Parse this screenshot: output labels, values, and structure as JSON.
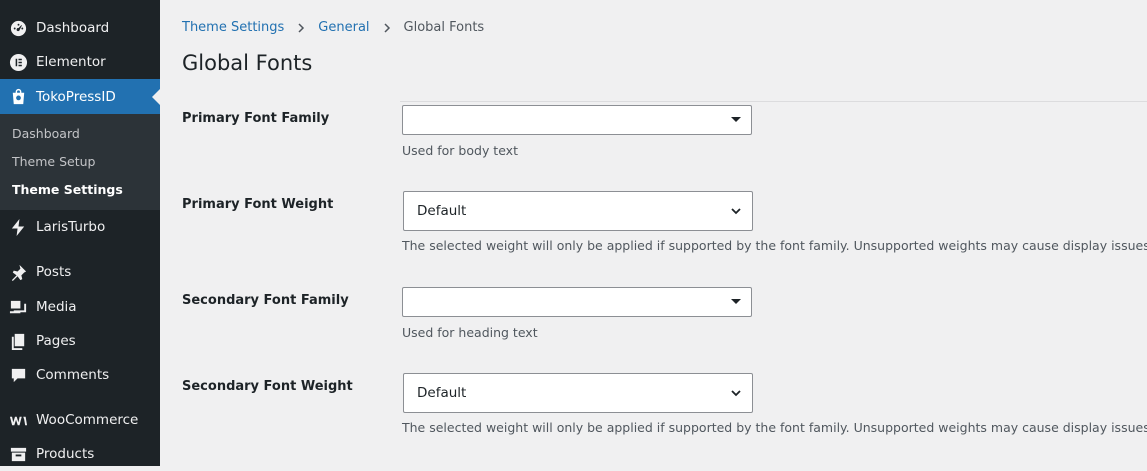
{
  "sidebar": {
    "items": [
      {
        "label": "Dashboard",
        "icon": "dashboard-icon"
      },
      {
        "label": "Elementor",
        "icon": "elementor-icon"
      },
      {
        "label": "TokoPressID",
        "icon": "shopping-bag-icon"
      },
      {
        "label": "LarisTurbo",
        "icon": "bolt-icon"
      },
      {
        "label": "Posts",
        "icon": "pushpin-icon"
      },
      {
        "label": "Media",
        "icon": "media-icon"
      },
      {
        "label": "Pages",
        "icon": "pages-icon"
      },
      {
        "label": "Comments",
        "icon": "comment-icon"
      },
      {
        "label": "WooCommerce",
        "icon": "woocommerce-icon"
      },
      {
        "label": "Products",
        "icon": "archive-icon"
      }
    ],
    "submenu": [
      {
        "label": "Dashboard"
      },
      {
        "label": "Theme Setup"
      },
      {
        "label": "Theme Settings"
      }
    ]
  },
  "breadcrumb": {
    "level1": "Theme Settings",
    "level2": "General",
    "current": "Global Fonts"
  },
  "page_title": "Global Fonts",
  "fields": [
    {
      "label": "Primary Font Family",
      "value": "",
      "help": "Used for body text"
    },
    {
      "label": "Primary Font Weight",
      "value": "Default",
      "help": "The selected weight will only be applied if supported by the font family. Unsupported weights may cause display issues."
    },
    {
      "label": "Secondary Font Family",
      "value": "",
      "help": "Used for heading text"
    },
    {
      "label": "Secondary Font Weight",
      "value": "Default",
      "help": "The selected weight will only be applied if supported by the font family. Unsupported weights may cause display issues."
    }
  ],
  "colors": {
    "sidebar_bg": "#1d2327",
    "accent": "#2271b1",
    "page_bg": "#f0f0f1"
  }
}
